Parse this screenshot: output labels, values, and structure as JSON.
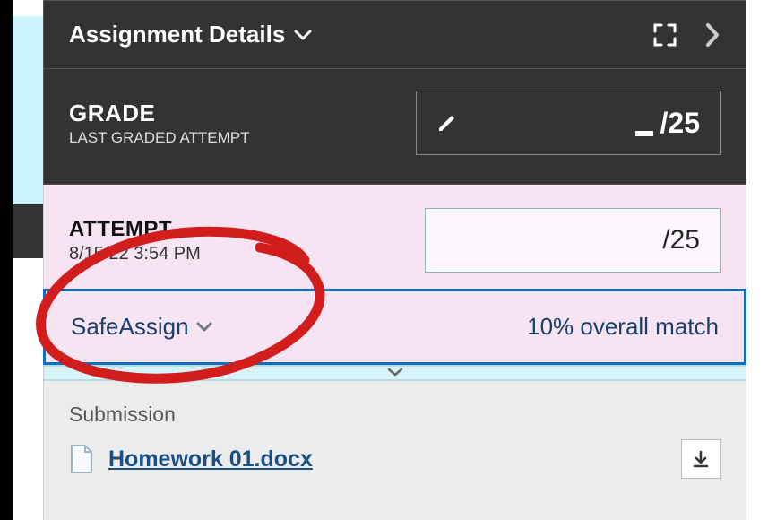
{
  "header": {
    "title": "Assignment Details"
  },
  "grade": {
    "heading": "GRADE",
    "subheading": "LAST GRADED ATTEMPT",
    "points_possible_display": "/25"
  },
  "attempt": {
    "heading": "ATTEMPT",
    "timestamp": "8/15/22 3:54 PM",
    "points_possible_display": "/25"
  },
  "safeassign": {
    "label": "SafeAssign",
    "match_text": "10% overall match"
  },
  "submission": {
    "heading": "Submission",
    "file_name": "Homework 01.docx"
  }
}
